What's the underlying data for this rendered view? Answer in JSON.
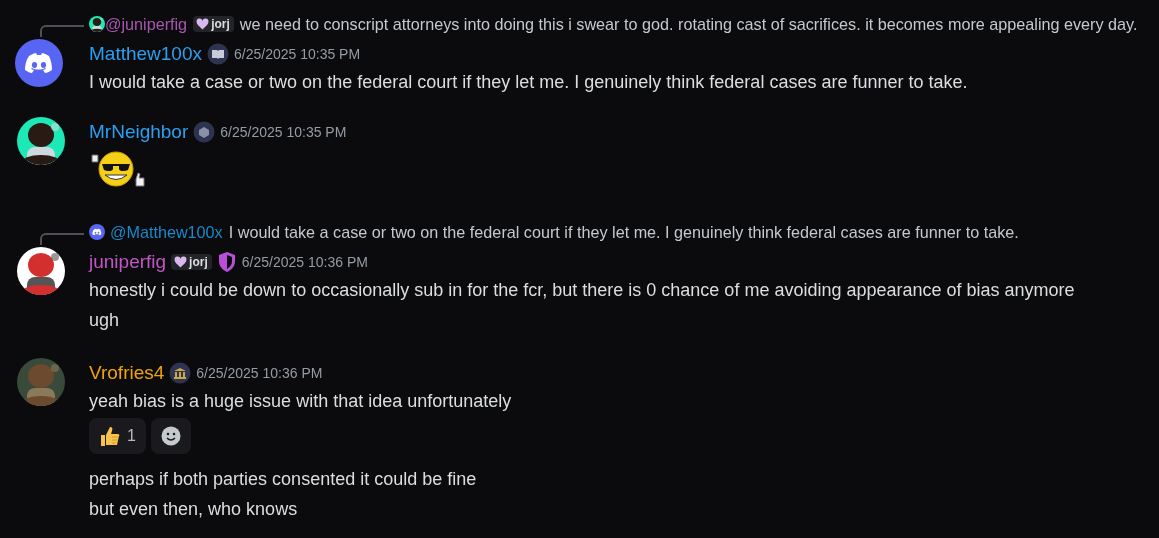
{
  "messages": [
    {
      "reply": {
        "avatar": {
          "kind": "picture"
        },
        "author": "@juniperfig",
        "color": "#a855b0",
        "tag": "jorj",
        "text": "we need to conscript attorneys into doing this i swear to god. rotating cast of sacrifices. it becomes more appealing every day."
      },
      "avatar": {
        "kind": "discord"
      },
      "author": "Matthew100x",
      "color": "#2b9ff0",
      "badge": {
        "kind": "book"
      },
      "timestamp": "6/25/2025 10:35 PM",
      "lines": [
        {
          "kind": "text",
          "text": "I would take a case or two on the federal court if they let me. I genuinely think federal cases are funner to take."
        }
      ]
    },
    {
      "avatar": {
        "kind": "picture"
      },
      "author": "MrNeighbor",
      "color": "#2b9ff0",
      "badge": {
        "kind": "box"
      },
      "timestamp": "6/25/2025 10:35 PM",
      "lines": [
        {
          "kind": "emoji"
        }
      ]
    },
    {
      "reply": {
        "avatar": {
          "kind": "discord"
        },
        "author": "@Matthew100x",
        "color": "#1a88c9",
        "text": "I would take a case or two on the federal court if they let me. I genuinely think federal cases are funner to take."
      },
      "avatar": {
        "kind": "picture"
      },
      "author": "juniperfig",
      "color": "#c155c6",
      "tag": "jorj",
      "badge": {
        "kind": "shield"
      },
      "timestamp": "6/25/2025 10:36 PM",
      "lines": [
        {
          "kind": "text",
          "text": "honestly i could be down to occasionally sub in for the fcr, but there is 0 chance of me avoiding appearance of bias anymore"
        },
        {
          "kind": "text",
          "text": "ugh"
        }
      ]
    },
    {
      "avatar": {
        "kind": "picture"
      },
      "author": "Vrofries4",
      "color": "#f0a30a",
      "badge": {
        "kind": "bank"
      },
      "timestamp": "6/25/2025 10:36 PM",
      "lines": [
        {
          "kind": "text",
          "text": "yeah bias is a huge issue with that idea unfortunately"
        },
        {
          "kind": "reactions",
          "reactions": [
            {
              "count": "1",
              "selected": false
            }
          ]
        },
        {
          "kind": "text",
          "text": "perhaps if both parties consented it could be fine"
        },
        {
          "kind": "text",
          "text": "but even then, who knows"
        }
      ]
    }
  ]
}
